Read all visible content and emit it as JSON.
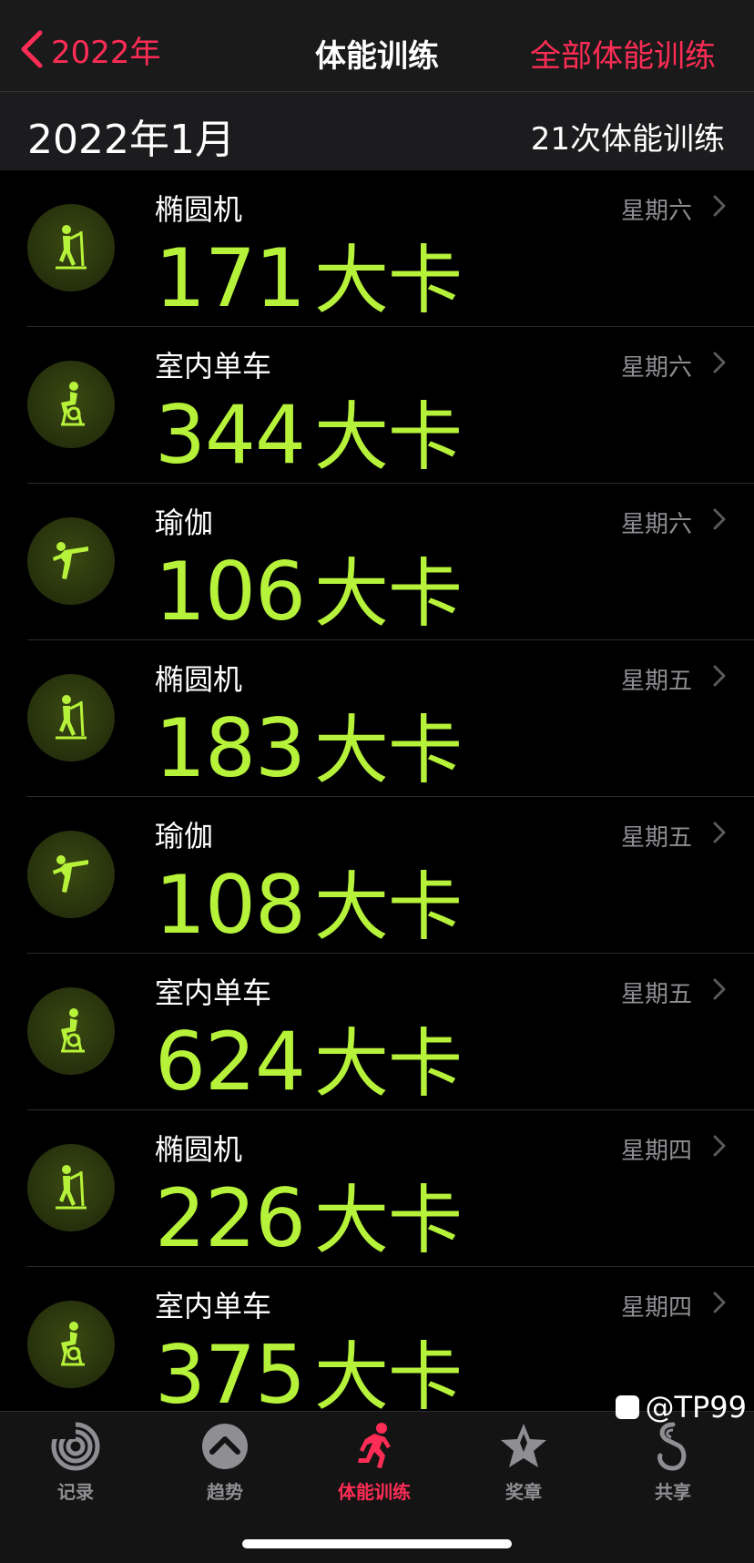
{
  "navbar": {
    "back_label": "2022年",
    "title": "体能训练",
    "right_label": "全部体能训练"
  },
  "section": {
    "month": "2022年1月",
    "count": "21次体能训练"
  },
  "colors": {
    "accent": "#ff2d55",
    "calories": "#b6f23a"
  },
  "workouts": [
    {
      "name": "椭圆机",
      "calories": "171",
      "unit": "大卡",
      "day": "星期六",
      "icon": "elliptical-icon"
    },
    {
      "name": "室内单车",
      "calories": "344",
      "unit": "大卡",
      "day": "星期六",
      "icon": "indoor-cycle-icon"
    },
    {
      "name": "瑜伽",
      "calories": "106",
      "unit": "大卡",
      "day": "星期六",
      "icon": "yoga-icon"
    },
    {
      "name": "椭圆机",
      "calories": "183",
      "unit": "大卡",
      "day": "星期五",
      "icon": "elliptical-icon"
    },
    {
      "name": "瑜伽",
      "calories": "108",
      "unit": "大卡",
      "day": "星期五",
      "icon": "yoga-icon"
    },
    {
      "name": "室内单车",
      "calories": "624",
      "unit": "大卡",
      "day": "星期五",
      "icon": "indoor-cycle-icon"
    },
    {
      "name": "椭圆机",
      "calories": "226",
      "unit": "大卡",
      "day": "星期四",
      "icon": "elliptical-icon"
    },
    {
      "name": "室内单车",
      "calories": "375",
      "unit": "大卡",
      "day": "星期四",
      "icon": "indoor-cycle-icon"
    }
  ],
  "tabs": [
    {
      "label": "记录",
      "icon": "activity-rings-icon",
      "active": false
    },
    {
      "label": "趋势",
      "icon": "trends-icon",
      "active": false
    },
    {
      "label": "体能训练",
      "icon": "running-figure-icon",
      "active": true
    },
    {
      "label": "奖章",
      "icon": "award-star-icon",
      "active": false
    },
    {
      "label": "共享",
      "icon": "sharing-icon",
      "active": false
    }
  ],
  "watermark": "@TP99"
}
